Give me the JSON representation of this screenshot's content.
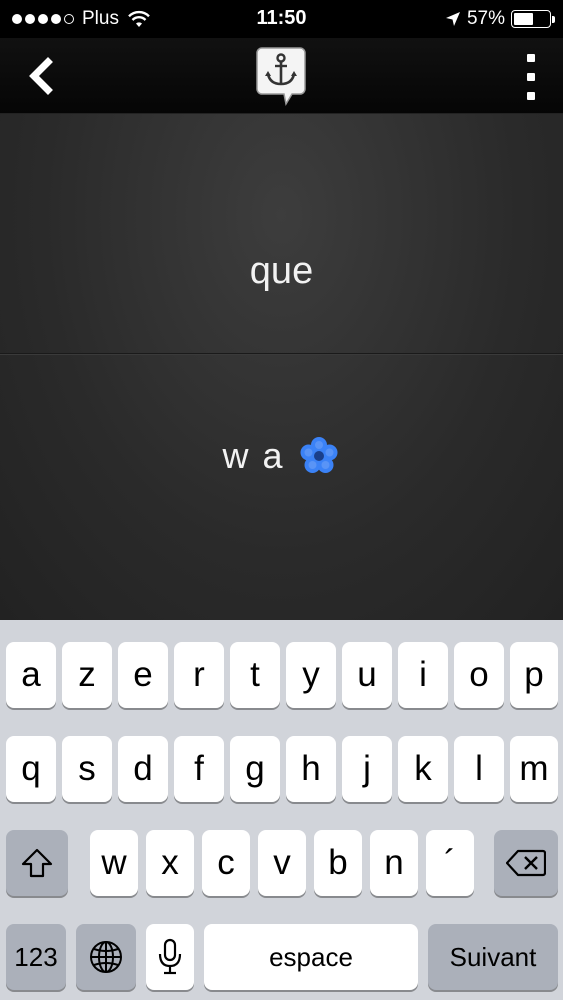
{
  "status_bar": {
    "carrier": "Plus",
    "time": "11:50",
    "battery_percent": "57%",
    "battery_level": 0.57,
    "signal_bars_filled": 4,
    "signal_bars_total": 5
  },
  "nav": {
    "back_icon": "chevron-left-icon",
    "logo_icon": "anchor-icon",
    "menu_icon": "vertical-dots-icon"
  },
  "card": {
    "prompt": "que",
    "answer": "w a",
    "loading_icon": "flower-spinner-icon"
  },
  "keyboard": {
    "row1": [
      "a",
      "z",
      "e",
      "r",
      "t",
      "y",
      "u",
      "i",
      "o",
      "p"
    ],
    "row2": [
      "q",
      "s",
      "d",
      "f",
      "g",
      "h",
      "j",
      "k",
      "l",
      "m"
    ],
    "row3": [
      "w",
      "x",
      "c",
      "v",
      "b",
      "n",
      "´"
    ],
    "numbers_label": "123",
    "space_label": "espace",
    "return_label": "Suivant",
    "shift_icon": "shift-icon",
    "delete_icon": "backspace-icon",
    "globe_icon": "globe-icon",
    "mic_icon": "microphone-icon"
  },
  "colors": {
    "accent": "#3b82f6",
    "keyboard_bg": "#d1d4da",
    "key_dark": "#abb0ba"
  }
}
